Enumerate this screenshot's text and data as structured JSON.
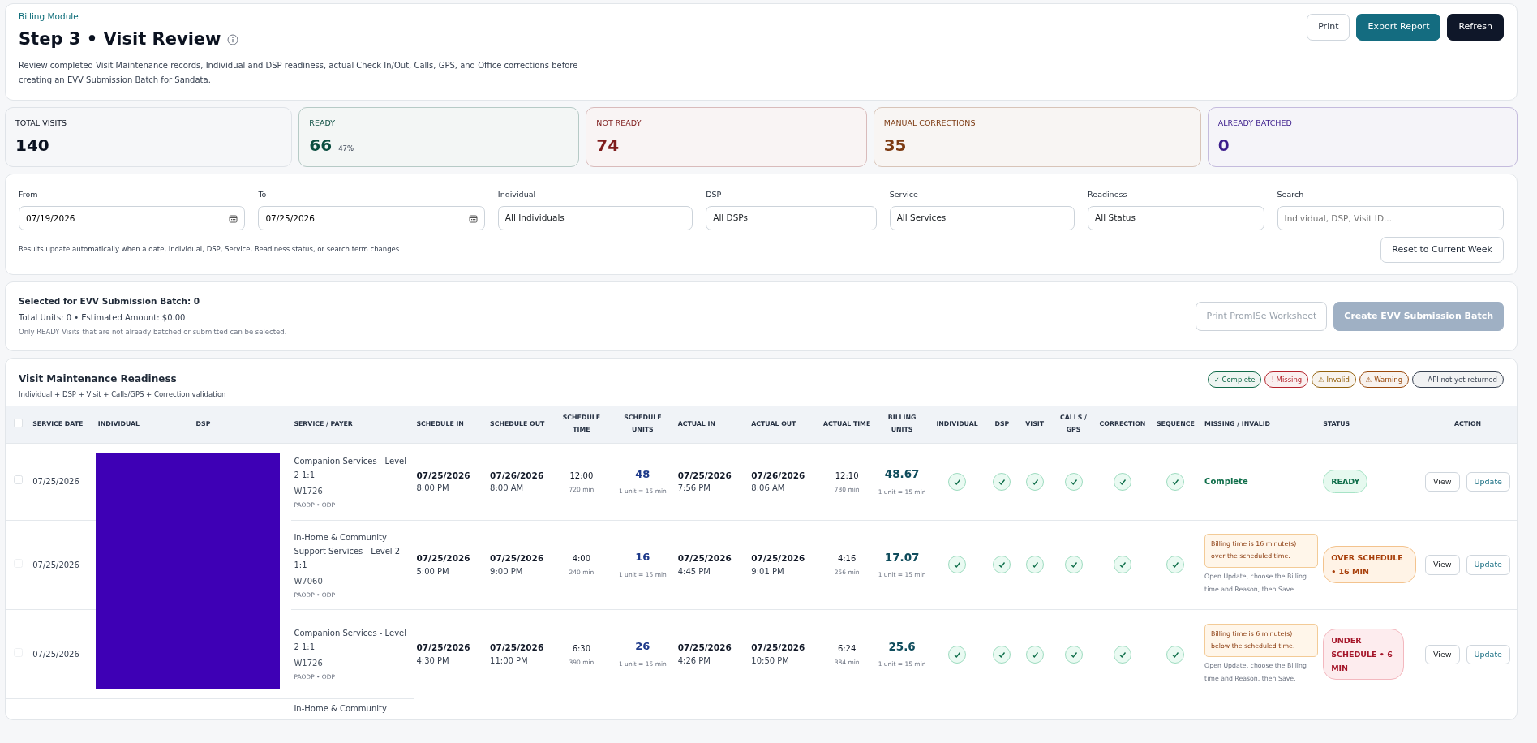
{
  "header": {
    "breadcrumb": "Billing Module",
    "title": "Step 3 • Visit Review",
    "description": "Review completed Visit Maintenance records, Individual and DSP readiness, actual Check In/Out, Calls, GPS, and Office corrections before creating an EVV Submission Batch for Sandata.",
    "buttons": [
      {
        "label": "Print",
        "kind": "outline"
      },
      {
        "label": "Export Report",
        "kind": "teal"
      },
      {
        "label": "Refresh",
        "kind": "dark"
      }
    ]
  },
  "stats": [
    {
      "label": "TOTAL VISITS",
      "value": "140",
      "color": "#0b1220"
    },
    {
      "label": "READY",
      "value": "66",
      "note": "47%",
      "color": "#0b4d40"
    },
    {
      "label": "NOT READY",
      "value": "74",
      "color": "#7f1d1d"
    },
    {
      "label": "MANUAL CORRECTIONS",
      "value": "35",
      "color": "#7c3a12"
    },
    {
      "label": "ALREADY BATCHED",
      "value": "0",
      "color": "#3b1c8c"
    }
  ],
  "filters": {
    "fields": [
      {
        "label": "From",
        "kind": "date",
        "value": "07/19/2026"
      },
      {
        "label": "To",
        "kind": "date",
        "value": "07/25/2026"
      },
      {
        "label": "Individual",
        "kind": "select",
        "value": "All Individuals"
      },
      {
        "label": "DSP",
        "kind": "select",
        "value": "All DSPs"
      },
      {
        "label": "Service",
        "kind": "select",
        "value": "All Services"
      },
      {
        "label": "Readiness",
        "kind": "select",
        "value": "All Status"
      },
      {
        "label": "Search",
        "kind": "text",
        "placeholder": "Individual, DSP, Visit ID..."
      }
    ],
    "note": "Results update automatically when a date, Individual, DSP, Service, Readiness status, or search term changes.",
    "reset_button": "Reset to Current Week"
  },
  "batch": {
    "title": "Selected for EVV Submission Batch: 0",
    "totals": "Total Units: 0 • Estimated Amount: $0.00",
    "note": "Only READY Visits that are not already batched or submitted can be selected.",
    "buttons": [
      {
        "label": "Print PromISe Worksheet",
        "disabled": true,
        "kind": "outline"
      },
      {
        "label": "Create EVV Submission Batch",
        "disabled": true,
        "kind": "solid"
      }
    ]
  },
  "table": {
    "title": "Visit Maintenance Readiness",
    "subtitle": "Individual + DSP + Visit + Calls/GPS + Correction validation",
    "legend": [
      {
        "label": "✓ Complete",
        "color": "#126a4a"
      },
      {
        "label": "! Missing",
        "color": "#b4232c"
      },
      {
        "label": "⚠ Invalid",
        "color": "#94620e"
      },
      {
        "label": "⚠ Warning",
        "color": "#9a4a0d"
      },
      {
        "label": "— API not yet returned",
        "color": "#374151"
      }
    ],
    "select_all": {
      "checked": false
    },
    "columns": [
      "SERVICE DATE",
      "INDIVIDUAL",
      "DSP",
      "SERVICE / PAYER",
      "SCHEDULE IN",
      "SCHEDULE OUT",
      "SCHEDULE TIME",
      "SCHEDULE UNITS",
      "ACTUAL IN",
      "ACTUAL OUT",
      "ACTUAL TIME",
      "BILLING UNITS",
      "INDIVIDUAL",
      "DSP",
      "VISIT",
      "CALLS / GPS",
      "CORRECTION",
      "SEQUENCE",
      "MISSING / INVALID",
      "STATUS",
      "ACTION"
    ],
    "rows": [
      {
        "checked": false,
        "disabled": false,
        "date": "07/25/2026",
        "service": "Companion Services - Level 2 1:1",
        "code": "W1726",
        "payer": "PAODP • ODP",
        "sched_in": [
          "07/25/2026",
          "8:00 PM"
        ],
        "sched_out": [
          "07/26/2026",
          "8:00 AM"
        ],
        "sched_time": "12:00",
        "sched_min": "720 min",
        "units": "48",
        "unit_note": "1 unit = 15 min",
        "actual_in": [
          "07/25/2026",
          "7:56 PM"
        ],
        "actual_out": [
          "07/26/2026",
          "8:06 AM"
        ],
        "actual_time": "12:10",
        "actual_min": "730 min",
        "billing_units": "48.67",
        "billing_note": "1 unit = 15 min",
        "checks": [
          {
            "kind": "ok"
          },
          {
            "kind": "ok"
          },
          {
            "kind": "ok"
          },
          {
            "kind": "ok"
          },
          {
            "kind": "ok"
          },
          {
            "kind": "ok"
          }
        ],
        "missing": {
          "kind": "complete",
          "text": "Complete"
        },
        "status": {
          "label": "READY",
          "kind": "ready"
        },
        "actions": [
          "View",
          "Update"
        ]
      },
      {
        "checked": false,
        "disabled": true,
        "date": "07/25/2026",
        "service": "In-Home & Community Support Services - Level 2 1:1",
        "code": "W7060",
        "payer": "PAODP • ODP",
        "sched_in": [
          "07/25/2026",
          "5:00 PM"
        ],
        "sched_out": [
          "07/25/2026",
          "9:00 PM"
        ],
        "sched_time": "4:00",
        "sched_min": "240 min",
        "units": "16",
        "unit_note": "1 unit = 15 min",
        "actual_in": [
          "07/25/2026",
          "4:45 PM"
        ],
        "actual_out": [
          "07/25/2026",
          "9:01 PM"
        ],
        "actual_time": "4:16",
        "actual_min": "256 min",
        "billing_units": "17.07",
        "billing_note": "1 unit = 15 min",
        "checks": [
          {
            "kind": "ok"
          },
          {
            "kind": "ok"
          },
          {
            "kind": "ok"
          },
          {
            "kind": "ok"
          },
          {
            "kind": "ok"
          },
          {
            "kind": "ok"
          }
        ],
        "missing": {
          "kind": "issue",
          "text": "Billing time is 16 minute(s) over the scheduled time.",
          "hint": "Open Update, choose the Billing time and Reason, then Save."
        },
        "status": {
          "label": "OVER SCHEDULE • 16 MIN",
          "kind": "over"
        },
        "actions": [
          "View",
          "Update"
        ]
      },
      {
        "checked": false,
        "disabled": true,
        "date": "07/25/2026",
        "service": "Companion Services - Level 2 1:1",
        "code": "W1726",
        "payer": "PAODP • ODP",
        "sched_in": [
          "07/25/2026",
          "4:30 PM"
        ],
        "sched_out": [
          "07/25/2026",
          "11:00 PM"
        ],
        "sched_time": "6:30",
        "sched_min": "390 min",
        "units": "26",
        "unit_note": "1 unit = 15 min",
        "actual_in": [
          "07/25/2026",
          "4:26 PM"
        ],
        "actual_out": [
          "07/25/2026",
          "10:50 PM"
        ],
        "actual_time": "6:24",
        "actual_min": "384 min",
        "billing_units": "25.6",
        "billing_note": "1 unit = 15 min",
        "checks": [
          {
            "kind": "ok"
          },
          {
            "kind": "ok"
          },
          {
            "kind": "ok"
          },
          {
            "kind": "ok"
          },
          {
            "kind": "ok"
          },
          {
            "kind": "ok"
          }
        ],
        "missing": {
          "kind": "issue",
          "text": "Billing time is 6 minute(s) below the scheduled time.",
          "hint": "Open Update, choose the Billing time and Reason, then Save."
        },
        "status": {
          "label": "UNDER SCHEDULE • 6 MIN",
          "kind": "under"
        },
        "actions": [
          "View",
          "Update"
        ]
      }
    ],
    "partial_row": {
      "service": "In-Home & Community"
    }
  }
}
